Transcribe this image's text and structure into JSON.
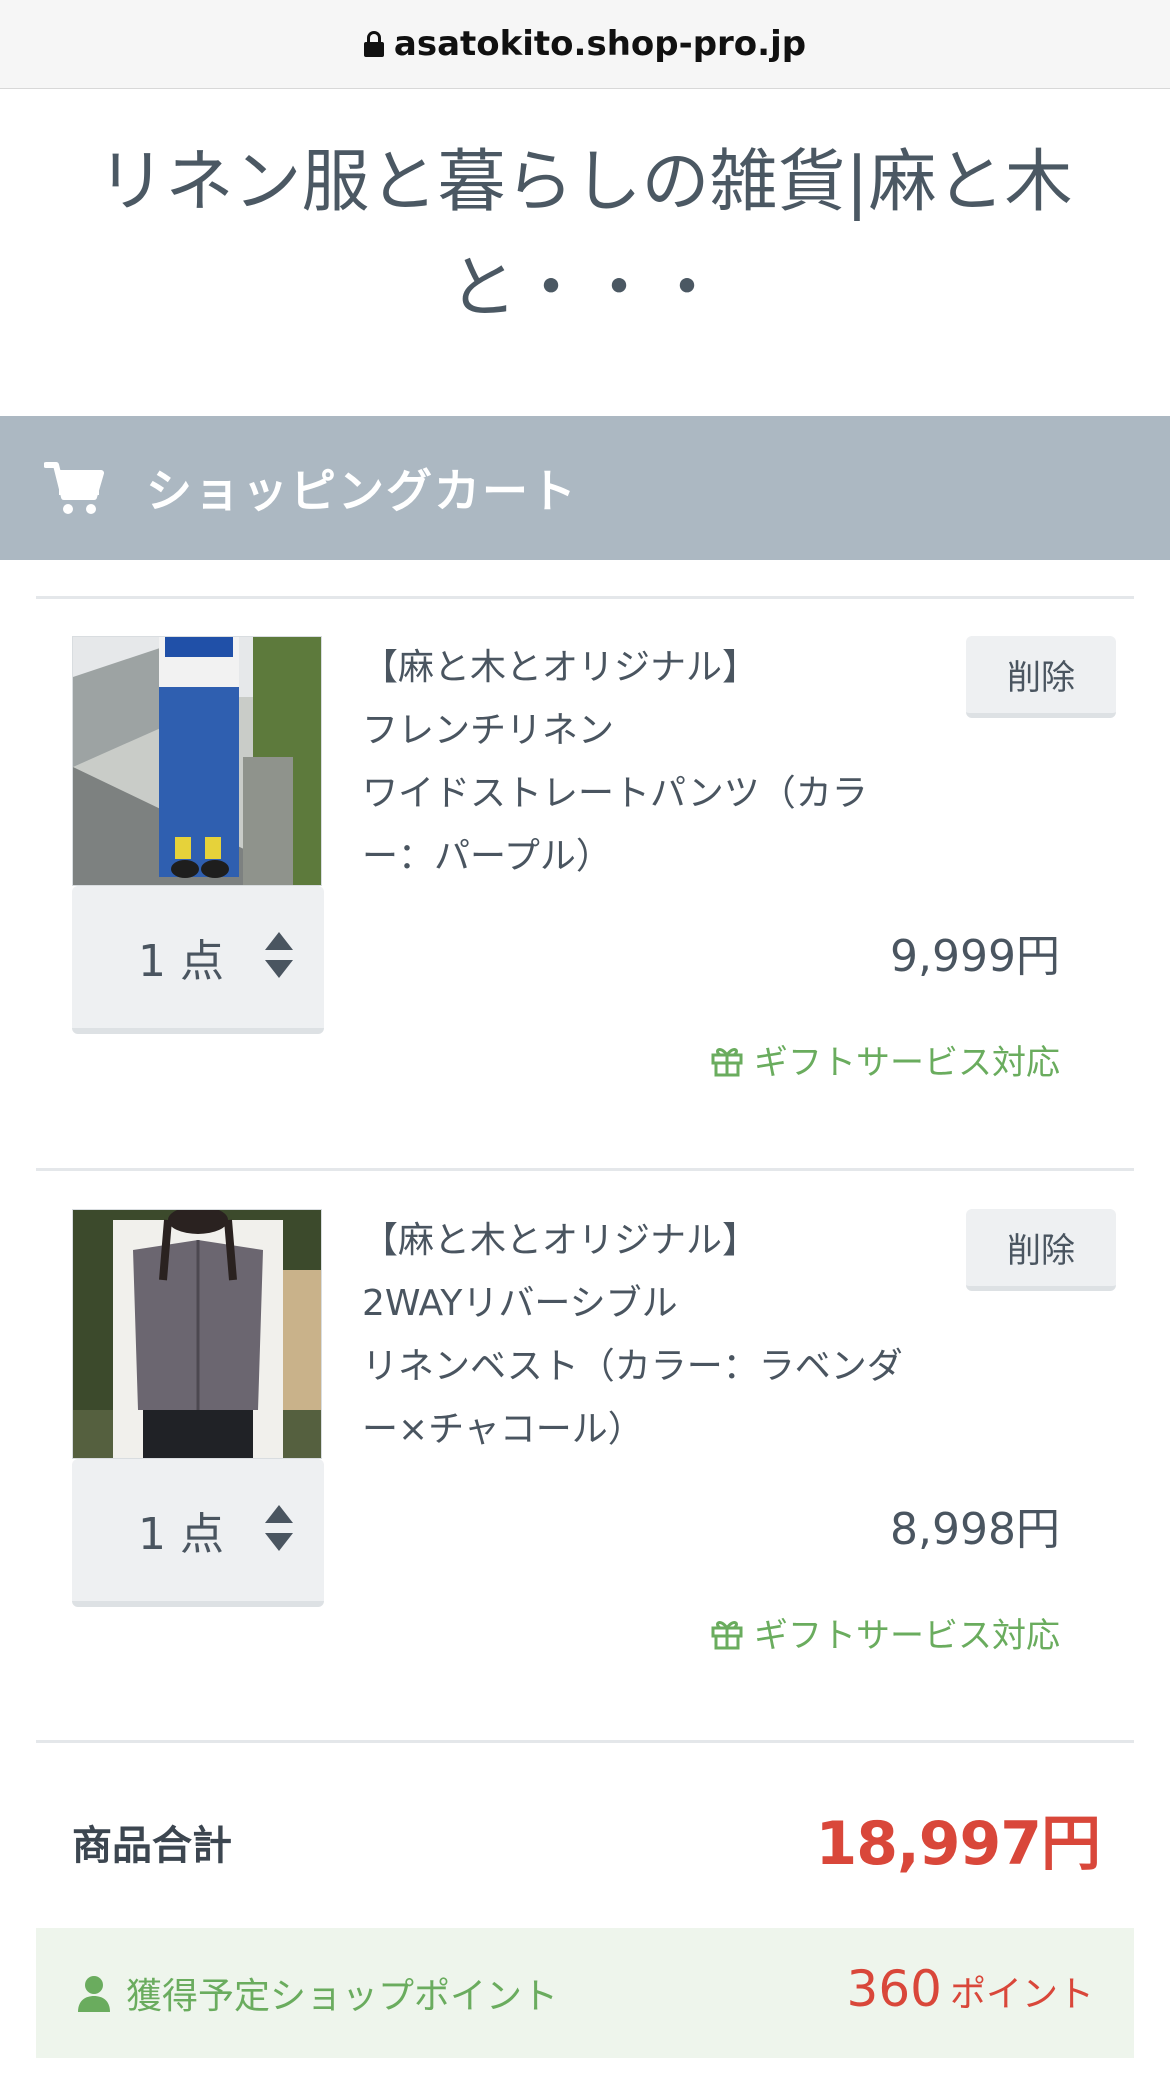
{
  "browser": {
    "url": "asatokito.shop-pro.jp"
  },
  "site": {
    "title": "リネン服と暮らしの雑貨|麻と木と・・・"
  },
  "cart": {
    "heading": "ショッピングカート"
  },
  "items": [
    {
      "name_lines": [
        "【麻と木とオリジナル】",
        "フレンチリネン",
        "ワイドストレートパンツ（カラ",
        "ー：パープル）"
      ],
      "delete_label": "削除",
      "quantity_label": "1 点",
      "price": "9,999円",
      "gift_label": "ギフトサービス対応"
    },
    {
      "name_lines": [
        "【麻と木とオリジナル】",
        "2WAYリバーシブル",
        "リネンベスト（カラー：ラベンダ",
        "ー×チャコール）"
      ],
      "delete_label": "削除",
      "quantity_label": "1 点",
      "price": "8,998円",
      "gift_label": "ギフトサービス対応"
    }
  ],
  "summary": {
    "subtotal_label": "商品合計",
    "subtotal_value": "18,997円",
    "points_label": "獲得予定ショップポイント",
    "points_value": "360",
    "points_unit": "ポイント"
  },
  "colors": {
    "header_bar": "#acb8c2",
    "price_red": "#d9473a",
    "gift_green": "#6aac5e",
    "points_bg": "#eef5ec"
  },
  "icons": [
    "lock-icon",
    "cart-icon",
    "chevron-up-down-icon",
    "gift-icon",
    "user-icon"
  ]
}
